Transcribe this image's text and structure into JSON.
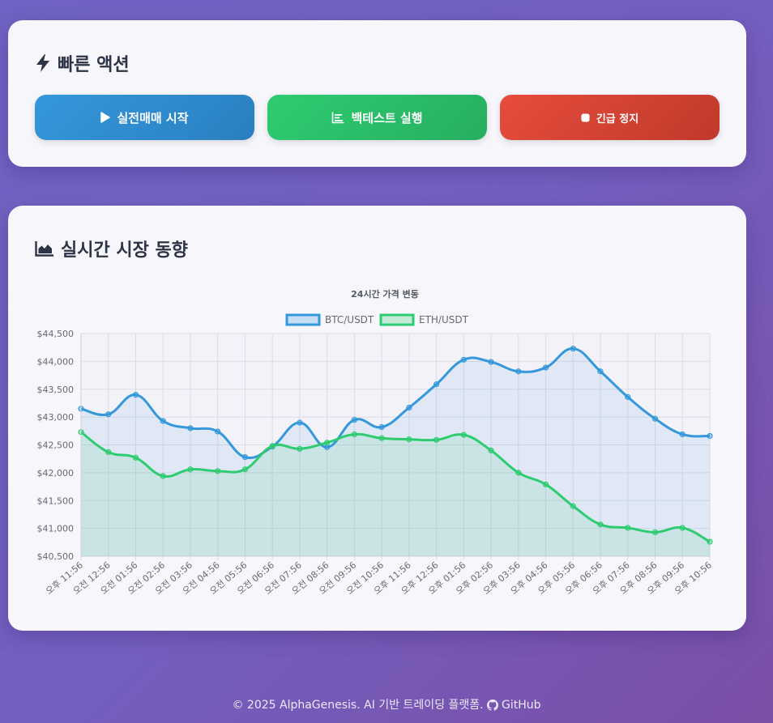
{
  "quick_actions": {
    "title": "빠른 액션",
    "icon": "bolt-icon",
    "buttons": [
      {
        "label": "실전매매 시작",
        "icon": "play-icon",
        "color": "#3498db"
      },
      {
        "label": "백테스트 실행",
        "icon": "chart-bar-icon",
        "color": "#2ecc71"
      },
      {
        "label": "긴급 정지",
        "icon": "stop-icon",
        "color": "#e74c3c"
      }
    ]
  },
  "market": {
    "title": "실시간 시장 동향",
    "icon": "chart-area-icon"
  },
  "chart_data": {
    "type": "line",
    "title": "24시간 가격 변동",
    "legend_position": "top",
    "grid": true,
    "categories": [
      "오후 11:56",
      "오전 12:56",
      "오전 01:56",
      "오전 02:56",
      "오전 03:56",
      "오전 04:56",
      "오전 05:56",
      "오전 06:56",
      "오전 07:56",
      "오전 08:56",
      "오전 09:56",
      "오전 10:56",
      "오후 11:56",
      "오후 12:56",
      "오후 01:56",
      "오후 02:56",
      "오후 03:56",
      "오후 04:56",
      "오후 05:56",
      "오후 06:56",
      "오후 07:56",
      "오후 08:56",
      "오후 09:56",
      "오후 10:56"
    ],
    "ylim": [
      40500,
      44500
    ],
    "yticks": [
      40500,
      41000,
      41500,
      42000,
      42500,
      43000,
      43500,
      44000,
      44500
    ],
    "ytick_labels": [
      "$40,500",
      "$41,000",
      "$41,500",
      "$42,000",
      "$42,500",
      "$43,000",
      "$43,500",
      "$44,000",
      "$44,500"
    ],
    "series": [
      {
        "name": "BTC/USDT",
        "color": "#3498db",
        "fill": "rgba(52,152,219,0.10)",
        "values": [
          43150,
          43050,
          43400,
          42930,
          42800,
          42740,
          42280,
          42470,
          42900,
          42460,
          42950,
          42820,
          43170,
          43590,
          44030,
          43990,
          43820,
          43890,
          44230,
          43820,
          43360,
          42970,
          42690,
          42660
        ]
      },
      {
        "name": "ETH/USDT",
        "color": "#2ecc71",
        "fill": "rgba(46,204,113,0.12)",
        "values": [
          42730,
          42370,
          42270,
          41940,
          42060,
          42030,
          42060,
          42480,
          42430,
          42540,
          42690,
          42620,
          42600,
          42590,
          42680,
          42400,
          42000,
          41790,
          41400,
          41070,
          41010,
          40930,
          41010,
          40760
        ]
      }
    ]
  },
  "footer": {
    "text": "© 2025 AlphaGenesis. AI 기반 트레이딩 플랫폼.",
    "github_label": "GitHub",
    "github_icon": "github-icon"
  }
}
